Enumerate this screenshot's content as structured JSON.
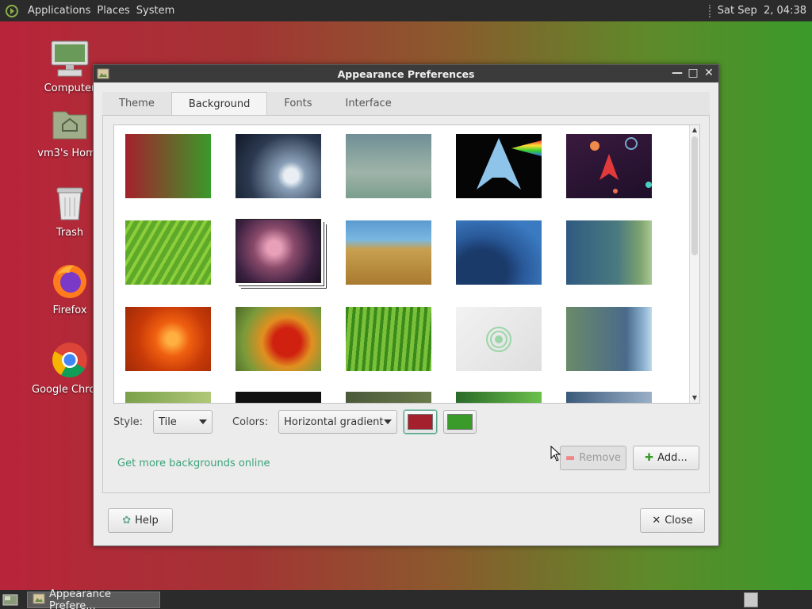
{
  "top_panel": {
    "menus": [
      "Applications",
      "Places",
      "System"
    ],
    "clock": "Sat Sep  2, 04:38"
  },
  "desktop_icons": [
    {
      "label": "Computer",
      "icon": "computer-icon"
    },
    {
      "label": "vm3's Home",
      "icon": "home-folder-icon"
    },
    {
      "label": "Trash",
      "icon": "trash-icon"
    },
    {
      "label": "Firefox",
      "icon": "firefox-icon"
    },
    {
      "label": "Google Chrome",
      "icon": "chrome-icon"
    }
  ],
  "window": {
    "title": "Appearance Preferences",
    "tabs": [
      "Theme",
      "Background",
      "Fonts",
      "Interface"
    ],
    "active_tab": "Background",
    "style_label": "Style:",
    "style_value": "Tile",
    "colors_label": "Colors:",
    "colors_value": "Horizontal gradient",
    "color1": "#a4202c",
    "color2": "#3a9a2a",
    "more_link": "Get more backgrounds online",
    "remove_label": "Remove",
    "add_label": "Add...",
    "help_label": "Help",
    "close_label": "Close"
  },
  "taskbar": {
    "task_label": "Appearance Prefere..."
  }
}
